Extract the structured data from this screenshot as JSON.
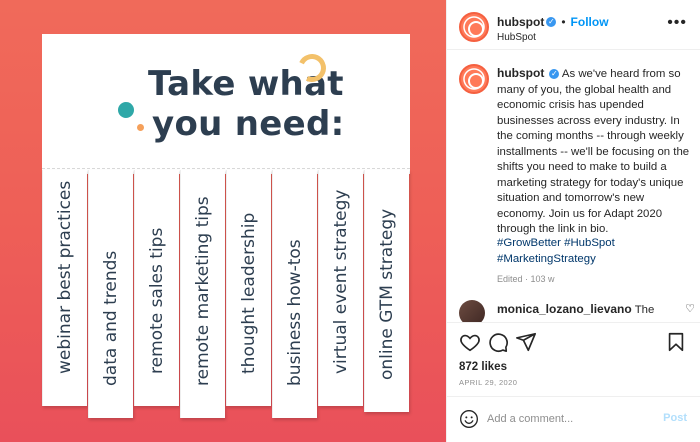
{
  "post_image": {
    "title_line1": "Take what",
    "title_line2": "you need:",
    "tabs": [
      "webinar best practices",
      "data and trends",
      "remote sales tips",
      "remote marketing tips",
      "thought leadership",
      "business how-tos",
      "virtual event strategy",
      "online GTM strategy"
    ],
    "colors": {
      "background_top": "#f06a5a",
      "background_bottom": "#e9505a",
      "text": "#2d3e50",
      "teal_dot": "#2fa8a8",
      "orange_dot": "#f5a05a",
      "arc": "#f3c16a"
    }
  },
  "header": {
    "username": "hubspot",
    "separator": "•",
    "follow_label": "Follow",
    "subtitle": "HubSpot",
    "more_icon": "more-horizontal-icon"
  },
  "caption": {
    "username": "hubspot",
    "text": "As we've heard from so many of you, the global health and economic crisis has upended businesses across every industry. In the coming months -- through weekly installments -- we'll be focusing on the shifts you need to make to build a marketing strategy for today's unique situation and tomorrow's new economy. Join us for Adapt 2020 through the link in bio.",
    "hashtags": "#GrowBetter #HubSpot #MarketingStrategy",
    "edited": "Edited · 103 w"
  },
  "comment": {
    "username": "monica_lozano_lievano",
    "text": "The"
  },
  "actions": {
    "likes": "872 likes",
    "date": "APRIL 29, 2020"
  },
  "add_comment": {
    "placeholder": "Add a comment...",
    "post_label": "Post"
  }
}
